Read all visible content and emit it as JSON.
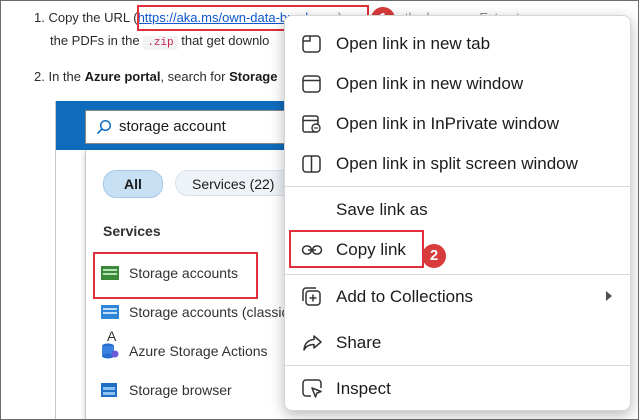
{
  "doc": {
    "step1_prefix": "1. Copy the URL (",
    "step1_url": "https://aka.ms/own-data-brochures",
    "step1_suffix": ") paste it in the browser. Extract",
    "step1_line2_a": "the PDFs in the ",
    "step1_code": ".zip",
    "step1_line2_b": " that get downlo",
    "step2_prefix": "2. In the ",
    "step2_bold1": "Azure portal",
    "step2_mid": ", search for ",
    "step2_bold2": "Storage"
  },
  "annotations": {
    "badge1": "1",
    "badge2": "2"
  },
  "azure": {
    "search_value": "storage account",
    "filter_all": "All",
    "filter_services": "Services  (22)",
    "section_services": "Services",
    "stray_letter": "A",
    "results": [
      {
        "label": "Storage accounts",
        "icon": "storage-accounts-icon"
      },
      {
        "label": "Storage accounts (classic",
        "icon": "storage-accounts-classic-icon"
      },
      {
        "label": "Azure Storage Actions",
        "icon": "storage-actions-icon"
      },
      {
        "label": "Storage browser",
        "icon": "storage-browser-icon"
      }
    ]
  },
  "context_menu": {
    "items": [
      {
        "label": "Open link in new tab",
        "icon": "new-tab-icon"
      },
      {
        "label": "Open link in new window",
        "icon": "new-window-icon"
      },
      {
        "label": "Open link in InPrivate window",
        "icon": "inprivate-icon"
      },
      {
        "label": "Open link in split screen window",
        "icon": "split-screen-icon"
      },
      {
        "label": "Save link as",
        "icon": ""
      },
      {
        "label": "Copy link",
        "icon": "link-icon"
      },
      {
        "label": "Add to Collections",
        "icon": "collections-icon"
      },
      {
        "label": "Share",
        "icon": "share-icon"
      },
      {
        "label": "Inspect",
        "icon": "inspect-icon"
      }
    ]
  },
  "colors": {
    "azure_blue": "#0f6cbd",
    "highlight_red": "#e0303a",
    "link_blue": "#0b57d0"
  }
}
